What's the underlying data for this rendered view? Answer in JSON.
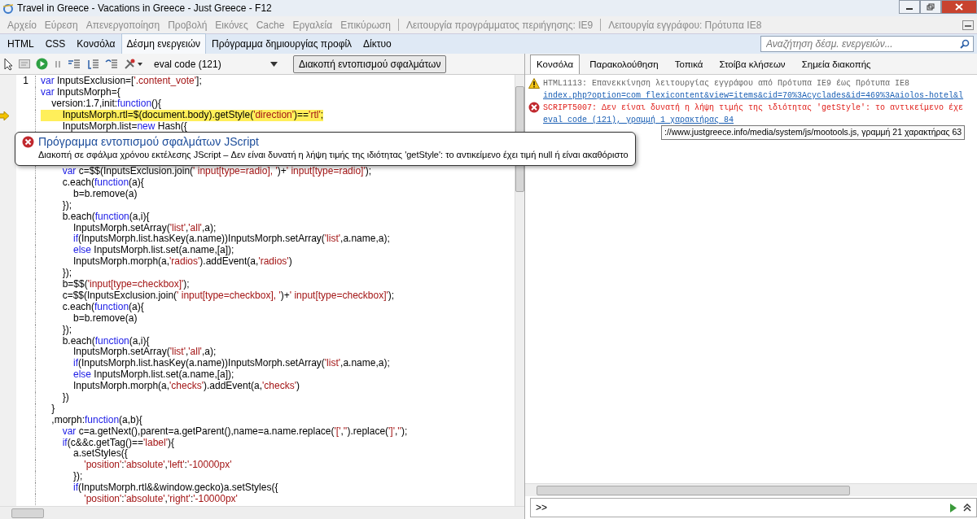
{
  "window": {
    "title": "Travel in Greece - Vacations in Greece - Just Greece - F12"
  },
  "menu": {
    "items": [
      {
        "label": "Αρχείο",
        "disabled": true
      },
      {
        "label": "Εύρεση",
        "disabled": true
      },
      {
        "label": "Απενεργοποίηση",
        "disabled": true
      },
      {
        "label": "Προβολή",
        "disabled": true
      },
      {
        "label": "Εικόνες",
        "disabled": true
      },
      {
        "label": "Cache",
        "disabled": true
      },
      {
        "label": "Εργαλεία",
        "disabled": true
      },
      {
        "label": "Επικύρωση",
        "disabled": true
      }
    ],
    "modes": [
      {
        "label": "Λειτουργία προγράμματος περιήγησης: IE9",
        "disabled": true
      },
      {
        "label": "Λειτουργία εγγράφου: Πρότυπα IE8",
        "disabled": true
      }
    ]
  },
  "tabs": [
    {
      "label": "HTML",
      "selected": false
    },
    {
      "label": "CSS",
      "selected": false
    },
    {
      "label": "Κονσόλα",
      "selected": false
    },
    {
      "label": "Δέσμη ενεργειών",
      "selected": true
    },
    {
      "label": "Πρόγραμμα δημιουργίας προφίλ",
      "selected": false
    },
    {
      "label": "Δίκτυο",
      "selected": false
    }
  ],
  "search": {
    "placeholder": "Αναζήτηση δέσμ. ενεργειών..."
  },
  "toolbar": {
    "script_select": "eval code (121)",
    "break_button": "Διακοπή εντοπισμού σφαλμάτων"
  },
  "code_lines": [
    {
      "number": "1",
      "current": false,
      "tokens": [
        {
          "kind": "keyword",
          "text": "var"
        },
        {
          "kind": "plain",
          "text": " InputsExclusion=["
        },
        {
          "kind": "string",
          "text": "'.content_vote'"
        },
        {
          "kind": "plain",
          "text": "];"
        }
      ]
    },
    {
      "current": false,
      "tokens": [
        {
          "kind": "keyword",
          "text": "var"
        },
        {
          "kind": "plain",
          "text": " InputsMorph={"
        }
      ]
    },
    {
      "current": false,
      "tokens": [
        {
          "kind": "plain",
          "text": "    version:1.7,init:"
        },
        {
          "kind": "keyword",
          "text": "function"
        },
        {
          "kind": "plain",
          "text": "(){"
        }
      ]
    },
    {
      "current": true,
      "tokens": [
        {
          "kind": "plain",
          "text": "        InputsMorph.rtl=$(document.body).getStyle("
        },
        {
          "kind": "string",
          "text": "'direction'"
        },
        {
          "kind": "plain",
          "text": ")=="
        },
        {
          "kind": "string",
          "text": "'rtl'"
        },
        {
          "kind": "plain",
          "text": ";"
        }
      ]
    },
    {
      "current": false,
      "tokens": [
        {
          "kind": "plain",
          "text": "        InputsMorph.list="
        },
        {
          "kind": "keyword",
          "text": "new"
        },
        {
          "kind": "plain",
          "text": " Hash({"
        }
      ],
      "popup": {
        "title": "Πρόγραμμα εντοπισμού σφαλμάτων JScript",
        "message": "Διακοπή σε σφάλμα χρόνου εκτέλεσης JScript – Δεν είναι δυνατή η λήψη τιμής της ιδιότητας 'getStyle': το αντικείμενο έχει τιμή null ή είναι ακαθόριστο"
      }
    },
    {
      "current": false,
      "tokens": [
        {
          "kind": "keyword",
          "text": "        var"
        },
        {
          "kind": "plain",
          "text": " c=$$(InputsExclusion.join("
        },
        {
          "kind": "string",
          "text": "' input[type=radio], '"
        },
        {
          "kind": "plain",
          "text": ")+"
        },
        {
          "kind": "string",
          "text": "' input[type=radio]'"
        },
        {
          "kind": "plain",
          "text": ");"
        }
      ]
    },
    {
      "current": false,
      "tokens": [
        {
          "kind": "plain",
          "text": "        c.each("
        },
        {
          "kind": "keyword",
          "text": "function"
        },
        {
          "kind": "plain",
          "text": "(a){"
        }
      ]
    },
    {
      "current": false,
      "tokens": [
        {
          "kind": "plain",
          "text": "            b=b.remove(a)"
        }
      ]
    },
    {
      "current": false,
      "tokens": [
        {
          "kind": "plain",
          "text": "        });"
        }
      ]
    },
    {
      "current": false,
      "tokens": [
        {
          "kind": "plain",
          "text": "        b.each("
        },
        {
          "kind": "keyword",
          "text": "function"
        },
        {
          "kind": "plain",
          "text": "(a,i){"
        }
      ]
    },
    {
      "current": false,
      "tokens": [
        {
          "kind": "plain",
          "text": "            InputsMorph.setArray("
        },
        {
          "kind": "string",
          "text": "'list'"
        },
        {
          "kind": "plain",
          "text": ","
        },
        {
          "kind": "string",
          "text": "'all'"
        },
        {
          "kind": "plain",
          "text": ",a);"
        }
      ]
    },
    {
      "current": false,
      "tokens": [
        {
          "kind": "keyword",
          "text": "            if"
        },
        {
          "kind": "plain",
          "text": "(InputsMorph.list.hasKey(a.name))InputsMorph.setArray("
        },
        {
          "kind": "string",
          "text": "'list'"
        },
        {
          "kind": "plain",
          "text": ",a.name,a);"
        }
      ]
    },
    {
      "current": false,
      "tokens": [
        {
          "kind": "keyword",
          "text": "            else"
        },
        {
          "kind": "plain",
          "text": " InputsMorph.list.set(a.name,[a]);"
        }
      ]
    },
    {
      "current": false,
      "tokens": [
        {
          "kind": "plain",
          "text": "            InputsMorph.morph(a,"
        },
        {
          "kind": "string",
          "text": "'radios'"
        },
        {
          "kind": "plain",
          "text": ").addEvent(a,"
        },
        {
          "kind": "string",
          "text": "'radios'"
        },
        {
          "kind": "plain",
          "text": ")"
        }
      ]
    },
    {
      "current": false,
      "tokens": [
        {
          "kind": "plain",
          "text": "        });"
        }
      ]
    },
    {
      "current": false,
      "tokens": [
        {
          "kind": "plain",
          "text": "        b=$$("
        },
        {
          "kind": "string",
          "text": "'input[type=checkbox]'"
        },
        {
          "kind": "plain",
          "text": ");"
        }
      ]
    },
    {
      "current": false,
      "tokens": [
        {
          "kind": "plain",
          "text": "        c=$$(InputsExclusion.join("
        },
        {
          "kind": "string",
          "text": "' input[type=checkbox], '"
        },
        {
          "kind": "plain",
          "text": ")+"
        },
        {
          "kind": "string",
          "text": "' input[type=checkbox]'"
        },
        {
          "kind": "plain",
          "text": ");"
        }
      ]
    },
    {
      "current": false,
      "tokens": [
        {
          "kind": "plain",
          "text": "        c.each("
        },
        {
          "kind": "keyword",
          "text": "function"
        },
        {
          "kind": "plain",
          "text": "(a){"
        }
      ]
    },
    {
      "current": false,
      "tokens": [
        {
          "kind": "plain",
          "text": "            b=b.remove(a)"
        }
      ]
    },
    {
      "current": false,
      "tokens": [
        {
          "kind": "plain",
          "text": "        });"
        }
      ]
    },
    {
      "current": false,
      "tokens": [
        {
          "kind": "plain",
          "text": "        b.each("
        },
        {
          "kind": "keyword",
          "text": "function"
        },
        {
          "kind": "plain",
          "text": "(a,i){"
        }
      ]
    },
    {
      "current": false,
      "tokens": [
        {
          "kind": "plain",
          "text": "            InputsMorph.setArray("
        },
        {
          "kind": "string",
          "text": "'list'"
        },
        {
          "kind": "plain",
          "text": ","
        },
        {
          "kind": "string",
          "text": "'all'"
        },
        {
          "kind": "plain",
          "text": ",a);"
        }
      ]
    },
    {
      "current": false,
      "tokens": [
        {
          "kind": "keyword",
          "text": "            if"
        },
        {
          "kind": "plain",
          "text": "(InputsMorph.list.hasKey(a.name))InputsMorph.setArray("
        },
        {
          "kind": "string",
          "text": "'list'"
        },
        {
          "kind": "plain",
          "text": ",a.name,a);"
        }
      ]
    },
    {
      "current": false,
      "tokens": [
        {
          "kind": "keyword",
          "text": "            else"
        },
        {
          "kind": "plain",
          "text": " InputsMorph.list.set(a.name,[a]);"
        }
      ]
    },
    {
      "current": false,
      "tokens": [
        {
          "kind": "plain",
          "text": "            InputsMorph.morph(a,"
        },
        {
          "kind": "string",
          "text": "'checks'"
        },
        {
          "kind": "plain",
          "text": ").addEvent(a,"
        },
        {
          "kind": "string",
          "text": "'checks'"
        },
        {
          "kind": "plain",
          "text": ")"
        }
      ]
    },
    {
      "current": false,
      "tokens": [
        {
          "kind": "plain",
          "text": "        })"
        }
      ]
    },
    {
      "current": false,
      "tokens": [
        {
          "kind": "plain",
          "text": "    }"
        }
      ]
    },
    {
      "current": false,
      "tokens": [
        {
          "kind": "plain",
          "text": "    ,morph:"
        },
        {
          "kind": "keyword",
          "text": "function"
        },
        {
          "kind": "plain",
          "text": "(a,b){"
        }
      ]
    },
    {
      "current": false,
      "tokens": [
        {
          "kind": "keyword",
          "text": "        var"
        },
        {
          "kind": "plain",
          "text": " c=a.getNext(),parent=a.getParent(),name=a.name.replace("
        },
        {
          "kind": "string",
          "text": "'['"
        },
        {
          "kind": "plain",
          "text": ","
        },
        {
          "kind": "string",
          "text": "''"
        },
        {
          "kind": "plain",
          "text": ").replace("
        },
        {
          "kind": "string",
          "text": "']'"
        },
        {
          "kind": "plain",
          "text": ","
        },
        {
          "kind": "string",
          "text": "''"
        },
        {
          "kind": "plain",
          "text": ");"
        }
      ]
    },
    {
      "current": false,
      "tokens": [
        {
          "kind": "keyword",
          "text": "        if"
        },
        {
          "kind": "plain",
          "text": "(c&&c.getTag()=="
        },
        {
          "kind": "string",
          "text": "'label'"
        },
        {
          "kind": "plain",
          "text": "){"
        }
      ]
    },
    {
      "current": false,
      "tokens": [
        {
          "kind": "plain",
          "text": "            a.setStyles({"
        }
      ]
    },
    {
      "current": false,
      "tokens": [
        {
          "kind": "string",
          "text": "                'position'"
        },
        {
          "kind": "plain",
          "text": ":"
        },
        {
          "kind": "string",
          "text": "'absolute'"
        },
        {
          "kind": "plain",
          "text": ","
        },
        {
          "kind": "string",
          "text": "'left'"
        },
        {
          "kind": "plain",
          "text": ":"
        },
        {
          "kind": "string",
          "text": "'-10000px'"
        }
      ]
    },
    {
      "current": false,
      "tokens": [
        {
          "kind": "plain",
          "text": "            });"
        }
      ]
    },
    {
      "current": false,
      "tokens": [
        {
          "kind": "keyword",
          "text": "            if"
        },
        {
          "kind": "plain",
          "text": "(InputsMorph.rtl&&window.gecko)a.setStyles({"
        }
      ]
    },
    {
      "current": false,
      "tokens": [
        {
          "kind": "string",
          "text": "                'position'"
        },
        {
          "kind": "plain",
          "text": ":"
        },
        {
          "kind": "string",
          "text": "'absolute'"
        },
        {
          "kind": "plain",
          "text": ","
        },
        {
          "kind": "string",
          "text": "'right'"
        },
        {
          "kind": "plain",
          "text": ":"
        },
        {
          "kind": "string",
          "text": "'-10000px'"
        }
      ]
    }
  ],
  "console_tabs": [
    {
      "label": "Κονσόλα",
      "selected": true
    },
    {
      "label": "Παρακολούθηση",
      "selected": false
    },
    {
      "label": "Τοπικά",
      "selected": false
    },
    {
      "label": "Στοίβα κλήσεων",
      "selected": false
    },
    {
      "label": "Σημεία διακοπής",
      "selected": false
    }
  ],
  "console_messages": [
    {
      "kind": "warning",
      "text": "HTML1113: Επανεκκίνηση λειτουργίας εγγράφου από Πρότυπα IE9 έως Πρότυπα IE8",
      "link": "index.php?option=com flexicontent&view=items&cid=70%3Acyclades&id=469%3Aaiolos-hotel&l"
    },
    {
      "kind": "error",
      "text": "SCRIPT5007: Δεν είναι δυνατή η λήψη τιμής της ιδιότητας 'getStyle': το αντικείμενο έχε",
      "link": "eval code (121), γραμμή 1 χαρακτήρας 84"
    }
  ],
  "tooltip": "://www.justgreece.info/media/system/js/mootools.js, γραμμή 21 χαρακτήρας 63",
  "console_input": {
    "prompt": ">>"
  }
}
